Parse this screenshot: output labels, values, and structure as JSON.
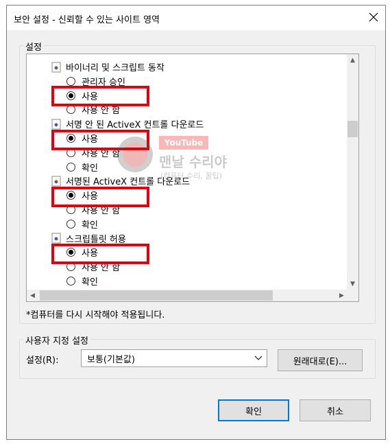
{
  "window": {
    "title": "보안 설정 - 신뢰할 수 있는 사이트 영역",
    "close_glyph": "✕"
  },
  "settings_group": {
    "label": "설정"
  },
  "list": {
    "rows": [
      {
        "kind": "category",
        "text": "바이너리 및 스크립트 동작"
      },
      {
        "kind": "radio",
        "text": "관리자 승인",
        "checked": false
      },
      {
        "kind": "radio",
        "text": "사용",
        "checked": true
      },
      {
        "kind": "radio",
        "text": "사용 안 함",
        "checked": false
      },
      {
        "kind": "category",
        "text": "서명 안 된 ActiveX 컨트롤 다운로드"
      },
      {
        "kind": "radio",
        "text": "사용",
        "checked": true
      },
      {
        "kind": "radio",
        "text": "사용 안 함",
        "checked": false
      },
      {
        "kind": "radio",
        "text": "확인",
        "checked": false
      },
      {
        "kind": "category",
        "text": "서명된 ActiveX 컨트롤 다운로드"
      },
      {
        "kind": "radio",
        "text": "사용",
        "checked": true
      },
      {
        "kind": "radio",
        "text": "사용 안 함",
        "checked": false
      },
      {
        "kind": "radio",
        "text": "확인",
        "checked": false
      },
      {
        "kind": "category",
        "text": "스크립틀릿 허용"
      },
      {
        "kind": "radio",
        "text": "사용",
        "checked": true
      },
      {
        "kind": "radio",
        "text": "사용 안 함",
        "checked": false
      },
      {
        "kind": "radio",
        "text": "확인",
        "checked": false
      }
    ],
    "vscroll_up": "▲",
    "vscroll_down": "▼",
    "hscroll_left": "◀",
    "hscroll_right": "▶"
  },
  "restart_note": "*컴퓨터를 다시 시작해야 적용됩니다.",
  "custom_group": {
    "label": "사용자 지정 설정",
    "setting_label": "설정(R):",
    "combo_value": "보통(기본값)",
    "reset_button": "원래대로(E)..."
  },
  "footer": {
    "ok_button": "확인",
    "cancel_button": "취소"
  },
  "watermark": {
    "badge": "YouTube",
    "channel": "맨날 수리야",
    "subtitle": "(컴퓨터 수리, 꿀팁)"
  },
  "colors": {
    "highlight": "#e0000f",
    "accent": "#0078d7"
  }
}
